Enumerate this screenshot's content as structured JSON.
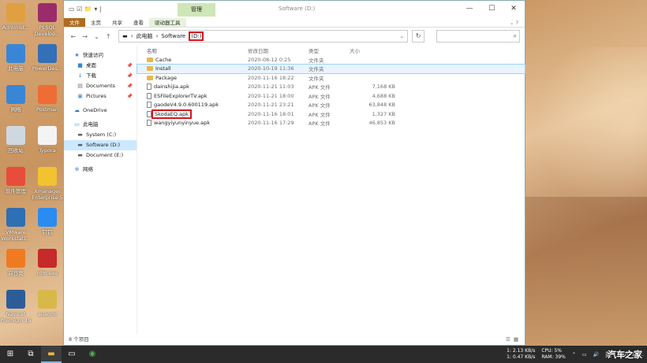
{
  "desktop": {
    "icons": [
      {
        "label": "Administ...",
        "icon": "user-folder-icon",
        "color": "#e0a040"
      },
      {
        "label": "PLSQL Develop...",
        "icon": "plsql-icon",
        "color": "#9b2c6b"
      },
      {
        "label": "此电脑",
        "icon": "computer-icon",
        "color": "#3a86d6"
      },
      {
        "label": "PowerDes...",
        "icon": "powerdesigner-icon",
        "color": "#3470b8"
      },
      {
        "label": "网络",
        "icon": "network-icon",
        "color": "#3a86d6"
      },
      {
        "label": "Postman",
        "icon": "postman-icon",
        "color": "#ef6c34"
      },
      {
        "label": "回收站",
        "icon": "recycle-bin-icon",
        "color": "#cfd8e0"
      },
      {
        "label": "Typora",
        "icon": "typora-icon",
        "color": "#f4f4f4"
      },
      {
        "label": "软件管理",
        "icon": "software-manager-icon",
        "color": "#e84c3d"
      },
      {
        "label": "Xmanager Enterprise 5",
        "icon": "xmanager-icon",
        "color": "#f2c230"
      },
      {
        "label": "VMware Workstati...",
        "icon": "vmware-icon",
        "color": "#2f6fb3"
      },
      {
        "label": "钉钉",
        "icon": "dingtalk-icon",
        "color": "#2a8cf0"
      },
      {
        "label": "向日葵",
        "icon": "sunflower-icon",
        "color": "#f07a22"
      },
      {
        "label": "rdm.exe",
        "icon": "redis-icon",
        "color": "#c62a2a"
      },
      {
        "label": "Navicat Premium 15",
        "icon": "navicat-icon",
        "color": "#2c5d98"
      },
      {
        "label": "auaomi",
        "icon": "generic-app-icon",
        "color": "#d9b84a"
      }
    ]
  },
  "explorer": {
    "title": "Software (D:)",
    "context_tab": "管理",
    "ribbon_tabs": [
      "文件",
      "主页",
      "共享",
      "查看",
      "驱动器工具"
    ],
    "address": {
      "pc": "此电脑",
      "drive_name": "Software",
      "drive_letter": "(D:)"
    },
    "nav": {
      "quick_access": "快速访问",
      "quick_items": [
        "桌面",
        "下载",
        "Documents",
        "Pictures"
      ],
      "onedrive": "OneDrive",
      "this_pc": "此电脑",
      "drives": [
        "System (C:)",
        "Software (D:)",
        "Document (E:)"
      ],
      "network": "网络"
    },
    "columns": {
      "name": "名称",
      "date": "修改日期",
      "type": "类型",
      "size": "大小"
    },
    "files": [
      {
        "name": "Cache",
        "date": "2020-08-12 0:25",
        "type": "文件夹",
        "size": "",
        "kind": "folder"
      },
      {
        "name": "Install",
        "date": "2020-10-19 11:36",
        "type": "文件夹",
        "size": "",
        "kind": "folder"
      },
      {
        "name": "Package",
        "date": "2020-11-16 18:22",
        "type": "文件夹",
        "size": "",
        "kind": "folder"
      },
      {
        "name": "dainshijia.apk",
        "date": "2020-11-21 11:03",
        "type": "APK 文件",
        "size": "7,168 KB",
        "kind": "file"
      },
      {
        "name": "ESFileExplorerTV.apk",
        "date": "2020-11-21 18:00",
        "type": "APK 文件",
        "size": "4,688 KB",
        "kind": "file"
      },
      {
        "name": "gaodeV4.9.0.600119.apk",
        "date": "2020-11-21 23:21",
        "type": "APK 文件",
        "size": "63,848 KB",
        "kind": "file"
      },
      {
        "name": "SkodaEQ.apk",
        "date": "2020-11-16 18:01",
        "type": "APK 文件",
        "size": "1,327 KB",
        "kind": "file"
      },
      {
        "name": "wangyiyunyinyue.apk",
        "date": "2020-11-16 17:29",
        "type": "APK 文件",
        "size": "46,853 KB",
        "kind": "file"
      }
    ],
    "status": "8 个项目"
  },
  "taskbar": {
    "net_up": "1: 2.13 KB/s",
    "net_down": "1: 0.47 KB/s",
    "cpu": "CPU: 5%",
    "ram": "RAM: 39%",
    "ime": "英",
    "time": "2020-11-..."
  },
  "watermark": "汽车之家"
}
